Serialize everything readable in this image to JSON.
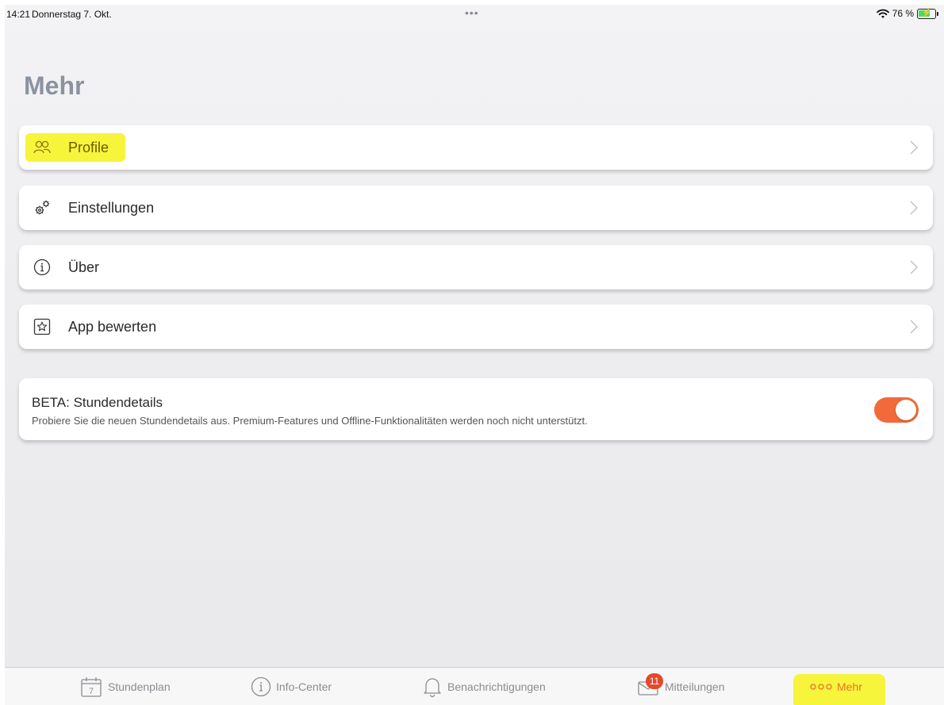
{
  "status": {
    "time": "14:21",
    "date": "Donnerstag 7. Okt.",
    "dots": "•••",
    "battery_percent": "76 %",
    "battery_level": 0.76
  },
  "page": {
    "title": "Mehr"
  },
  "menu": {
    "items": [
      {
        "label": "Profile",
        "icon": "profile-icon"
      },
      {
        "label": "Einstellungen",
        "icon": "gears-icon"
      },
      {
        "label": "Über",
        "icon": "info-icon"
      },
      {
        "label": "App bewerten",
        "icon": "star-icon"
      }
    ]
  },
  "beta": {
    "title": "BETA: Stundendetails",
    "description": "Probiere Sie die neuen Stundendetails aus. Premium-Features und Offline-Funktionalitäten werden noch nicht unterstützt.",
    "enabled": true
  },
  "tabs": [
    {
      "label": "Stundenplan",
      "icon": "calendar-icon",
      "icon_text": "7"
    },
    {
      "label": "Info-Center",
      "icon": "info-icon"
    },
    {
      "label": "Benachrichtigungen",
      "icon": "bell-icon"
    },
    {
      "label": "Mitteilungen",
      "icon": "mail-icon",
      "badge": "11"
    },
    {
      "label": "Mehr",
      "icon": "more-icon",
      "active": true
    }
  ],
  "colors": {
    "accent": "#f26a3a",
    "highlight": "#f7f43c",
    "title": "#8b93a1",
    "badge": "#e2492b"
  }
}
